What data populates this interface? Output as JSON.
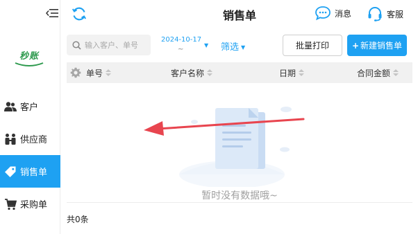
{
  "header": {
    "title": "销售单",
    "message_label": "消息",
    "service_label": "客服"
  },
  "brand": {
    "logo_text": "秒账"
  },
  "sidebar": {
    "items": [
      {
        "label": "客户",
        "icon": "users-icon",
        "active": false
      },
      {
        "label": "供应商",
        "icon": "supplier-icon",
        "active": false
      },
      {
        "label": "销售单",
        "icon": "tag-icon",
        "active": true
      },
      {
        "label": "采购单",
        "icon": "cart-icon",
        "active": false
      }
    ]
  },
  "toolbar": {
    "search_placeholder": "输入客户、单号",
    "date_value": "2024-10-17",
    "date_separator": "~",
    "filter_label": "筛选",
    "batch_print_label": "批量打印",
    "new_order_label": "新建销售单",
    "new_order_plus": "+"
  },
  "table": {
    "columns": [
      "单号",
      "客户名称",
      "日期",
      "合同金额"
    ]
  },
  "empty_state": {
    "text": "暂时没有数据哦~"
  },
  "footer": {
    "total_text": "共0条"
  },
  "colors": {
    "accent": "#1ea1f2",
    "annotation_arrow": "#e8454f"
  }
}
